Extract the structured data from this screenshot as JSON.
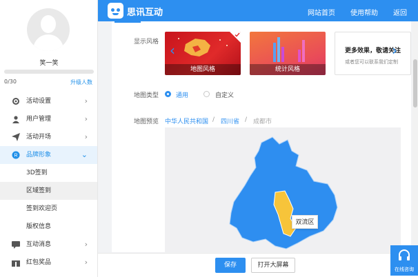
{
  "user": {
    "name": "笑一笑",
    "quota": "0/30",
    "upgrade_label": "升级人数"
  },
  "sidebar": {
    "items": [
      {
        "label": "活动设置",
        "icon": "gear-icon"
      },
      {
        "label": "用户管理",
        "icon": "user-icon"
      },
      {
        "label": "活动开场",
        "icon": "send-icon"
      },
      {
        "label": "品牌形象",
        "icon": "brand-icon"
      },
      {
        "label": "互动消息",
        "icon": "message-icon"
      },
      {
        "label": "红包奖品",
        "icon": "gift-icon"
      }
    ],
    "sub_items": [
      {
        "label": "3D签到"
      },
      {
        "label": "区域签到"
      },
      {
        "label": "签到欢迎页"
      },
      {
        "label": "版权信息"
      }
    ]
  },
  "header": {
    "brand": "思讯互动",
    "links": [
      {
        "label": "网站首页"
      },
      {
        "label": "使用帮助"
      },
      {
        "label": "返回"
      }
    ]
  },
  "form": {
    "style_label": "显示风格",
    "styles": [
      {
        "caption": "地图风格"
      },
      {
        "caption": "统计风格"
      }
    ],
    "more_title": "更多效果，敬请关注",
    "more_desc": "或者您可以联系我们定制",
    "map_type_label": "地图类型",
    "map_type_options": [
      {
        "label": "通用",
        "selected": true
      },
      {
        "label": "自定义",
        "selected": false
      }
    ],
    "preview_label": "地图预览",
    "breadcrumb": [
      {
        "label": "中华人民共和国"
      },
      {
        "label": "四川省"
      },
      {
        "label": "成都市"
      }
    ],
    "crumb_separator": "/",
    "tooltip": "双流区"
  },
  "actions": {
    "save": "保存",
    "open_screen": "打开大屏幕"
  },
  "help": {
    "label": "在线咨询"
  },
  "colors": {
    "accent": "#2d8ff0",
    "map_fill": "#2e8ef0",
    "map_highlight": "#f7c43a"
  }
}
